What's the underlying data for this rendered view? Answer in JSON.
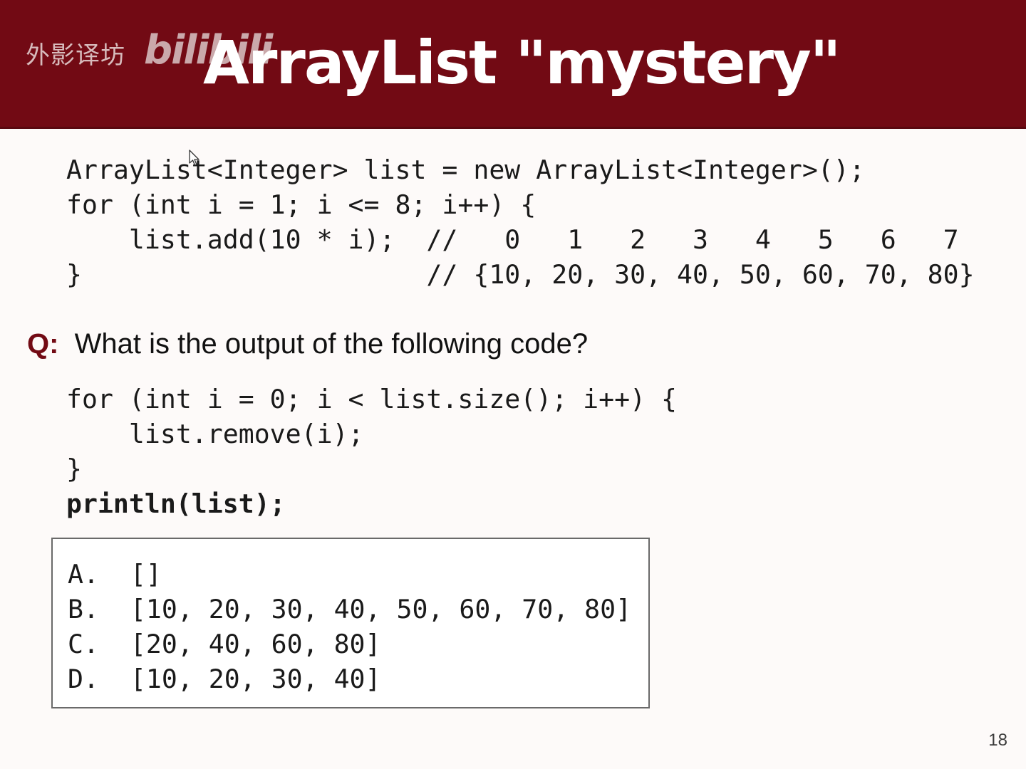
{
  "watermark": {
    "text": "外影译坊",
    "logo": "bilibili"
  },
  "slide": {
    "title": "ArrayList \"mystery\"",
    "page_number": "18"
  },
  "setup_code": [
    "ArrayList<Integer> list = new ArrayList<Integer>();",
    "for (int i = 1; i <= 8; i++) {",
    "    list.add(10 * i);  //   0   1   2   3   4   5   6   7",
    "}                      // {10, 20, 30, 40, 50, 60, 70, 80}"
  ],
  "question": {
    "label": "Q:",
    "text": "  What is the output of the following code?"
  },
  "question_code": [
    "for (int i = 0; i < list.size(); i++) {",
    "    list.remove(i);",
    "}",
    "println(list);"
  ],
  "answers": [
    "A.  []",
    "B.  [10, 20, 30, 40, 50, 60, 70, 80]",
    "C.  [20, 40, 60, 80]",
    "D.  [10, 20, 30, 40]"
  ],
  "icons": {
    "cursor": "mouse-pointer-icon"
  }
}
